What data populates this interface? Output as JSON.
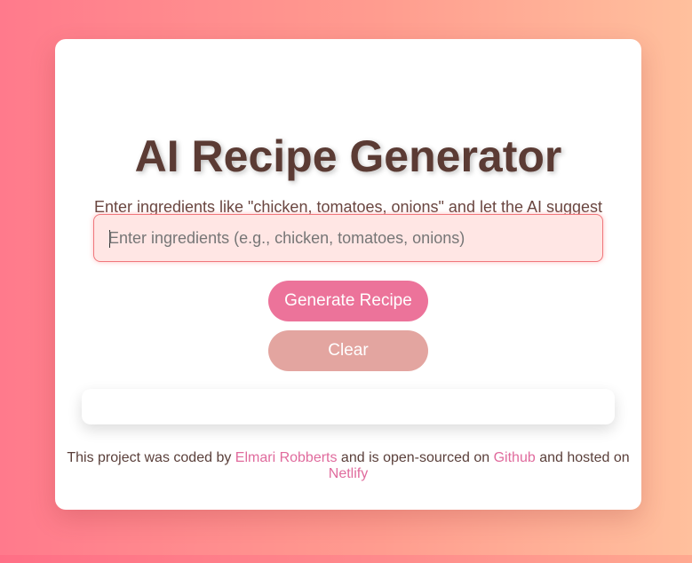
{
  "app": {
    "title": "AI Recipe Generator",
    "subtitle": "Enter ingredients like \"chicken, tomatoes, onions\" and let the AI suggest a recipe!"
  },
  "search": {
    "placeholder": "Enter ingredients (e.g., chicken, tomatoes, onions)",
    "value": ""
  },
  "actions": {
    "generate_label": "Generate Recipe",
    "clear_label": "Clear"
  },
  "result": {
    "text": ""
  },
  "footer": {
    "prefix": "This project was coded by ",
    "author_label": "Elmari Robberts",
    "middle": " and is open-sourced on ",
    "github_label": "Github",
    "suffix": " and hosted on ",
    "netlify_label": "Netlify"
  },
  "colors": {
    "title": "#5b3b34",
    "generate_button": "#ec739a",
    "clear_button": "#e3a5a0",
    "link": "#e06b9d"
  }
}
